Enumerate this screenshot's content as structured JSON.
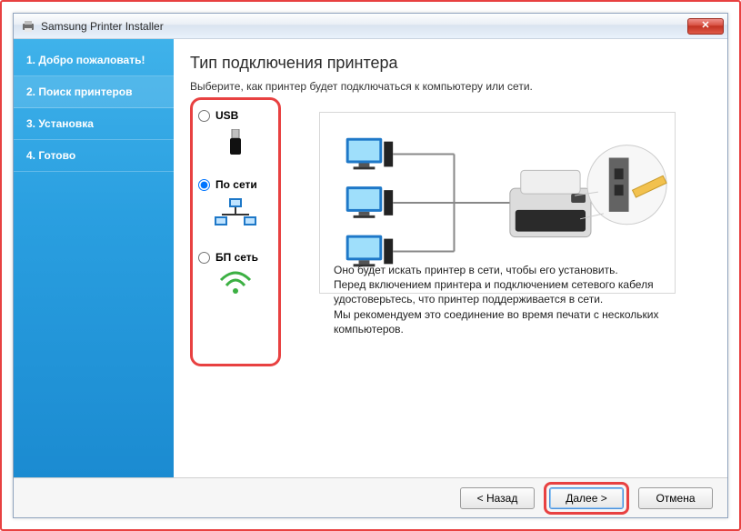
{
  "window": {
    "title": "Samsung Printer Installer"
  },
  "sidebar": {
    "steps": [
      "1. Добро пожаловать!",
      "2. Поиск принтеров",
      "3. Установка",
      "4. Готово"
    ]
  },
  "content": {
    "heading": "Тип подключения принтера",
    "subheading": "Выберите, как принтер будет подключаться к компьютеру или сети.",
    "options": {
      "usb": "USB",
      "network": "По сети",
      "wireless": "БП сеть"
    },
    "description": "Оно будет искать принтер в сети, чтобы его установить.\nПеред включением принтера и подключением сетевого кабеля удостоверьтесь, что принтер поддерживается в сети.\nМы рекомендуем это соединение во время печати с нескольких компьютеров."
  },
  "footer": {
    "back": "< Назад",
    "next": "Далее >",
    "cancel": "Отмена"
  }
}
